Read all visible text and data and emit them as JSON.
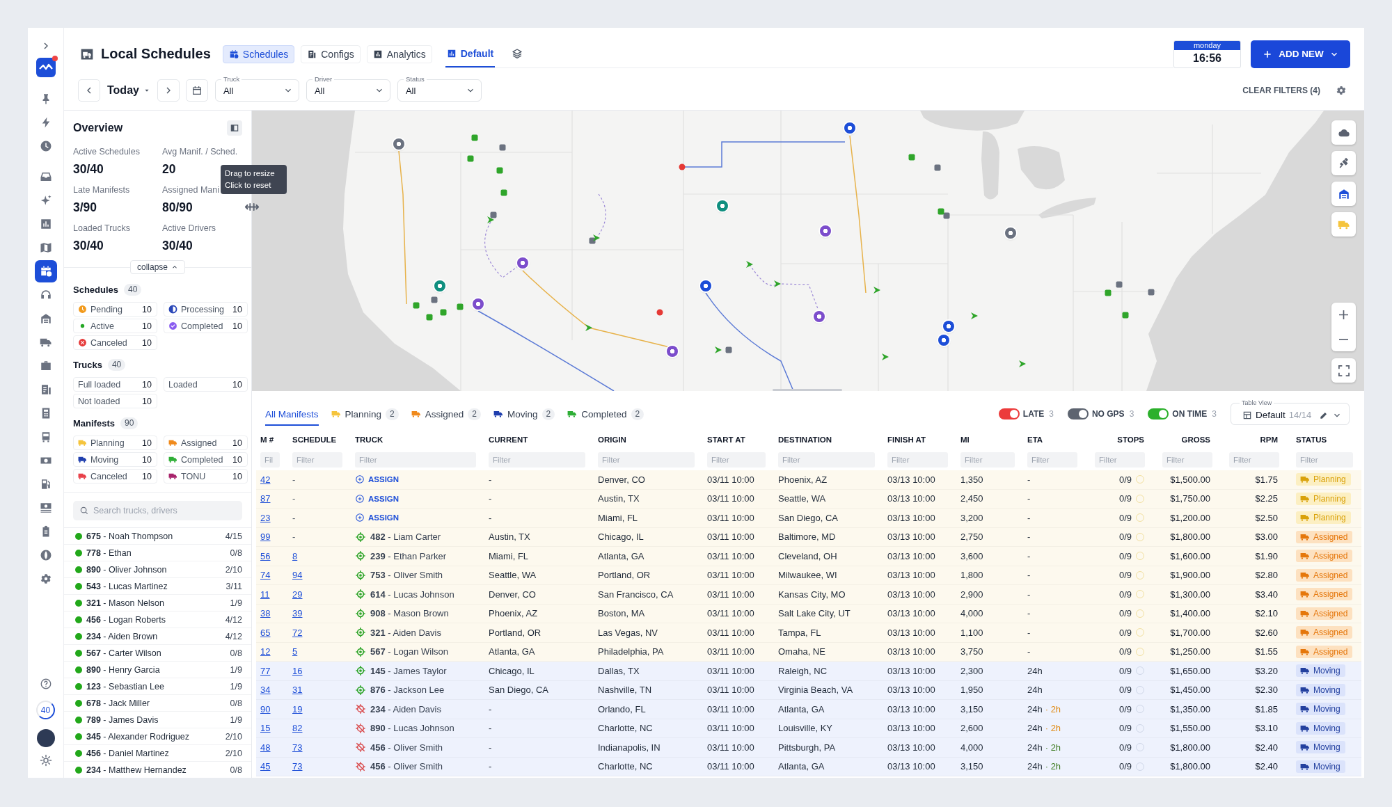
{
  "rail": {
    "groups": [
      [
        {
          "kind": "pin",
          "selected": false
        },
        {
          "kind": "bolt",
          "selected": false
        },
        {
          "kind": "clock",
          "selected": false
        }
      ],
      [
        {
          "kind": "inbox",
          "selected": false
        },
        {
          "kind": "sparkle",
          "selected": false
        },
        {
          "kind": "chart",
          "selected": false
        },
        {
          "kind": "map",
          "selected": false
        },
        {
          "kind": "calendar",
          "selected": true
        },
        {
          "kind": "headset",
          "selected": false
        },
        {
          "kind": "building",
          "selected": false
        },
        {
          "kind": "truck",
          "selected": false
        },
        {
          "kind": "briefcase",
          "selected": false
        },
        {
          "kind": "list",
          "selected": false
        },
        {
          "kind": "calculator",
          "selected": false
        },
        {
          "kind": "bus",
          "selected": false
        },
        {
          "kind": "banknote",
          "selected": false
        },
        {
          "kind": "fuel",
          "selected": false
        },
        {
          "kind": "cash",
          "selected": false
        },
        {
          "kind": "clipboard",
          "selected": false
        },
        {
          "kind": "globe",
          "selected": false
        },
        {
          "kind": "gear",
          "selected": false
        }
      ]
    ],
    "counter": "40"
  },
  "header": {
    "title": "Local Schedules",
    "view_tabs": [
      {
        "label": "Schedules",
        "selected": true
      },
      {
        "label": "Configs",
        "selected": false
      },
      {
        "label": "Analytics",
        "selected": false
      }
    ],
    "layout_tabs": [
      {
        "label": "Default",
        "selected": true
      }
    ],
    "clock": {
      "day": "monday",
      "time": "16:56"
    },
    "add_button": "ADD NEW"
  },
  "filters": {
    "date": "Today",
    "selects": [
      {
        "label": "Truck",
        "value": "All"
      },
      {
        "label": "Driver",
        "value": "All"
      },
      {
        "label": "Status",
        "value": "All"
      }
    ],
    "clear": "CLEAR FILTERS (4)"
  },
  "overview": {
    "title": "Overview",
    "stats": [
      {
        "label": "Active Schedules",
        "value": "30/40"
      },
      {
        "label": "Avg Manif. / Sched.",
        "value": "20"
      },
      {
        "label": "Late Manifests",
        "value": "3/90"
      },
      {
        "label": "Assigned Mani",
        "value": "80/90"
      },
      {
        "label": "Loaded Trucks",
        "value": "30/40"
      },
      {
        "label": "Active Drivers",
        "value": "30/40"
      }
    ],
    "collapse": "collapse",
    "tooltip": [
      "Drag to resize",
      "Click to reset"
    ]
  },
  "summary": [
    {
      "title": "Schedules",
      "count": "40",
      "chips": [
        {
          "label": "Pending",
          "value": "10",
          "kind": "pending",
          "color": "#f29a1c"
        },
        {
          "label": "Processing",
          "value": "10",
          "kind": "processing",
          "color": "#2a47b8"
        },
        {
          "label": "Active",
          "value": "10",
          "kind": "active",
          "color": "#25a825"
        },
        {
          "label": "Completed",
          "value": "10",
          "kind": "completed",
          "color": "#8a5cf0"
        },
        {
          "label": "Canceled",
          "value": "10",
          "kind": "canceled",
          "color": "#e63a3a"
        }
      ]
    },
    {
      "title": "Trucks",
      "count": "40",
      "chips": [
        {
          "label": "Full loaded",
          "value": "10",
          "kind": "plain"
        },
        {
          "label": "Loaded",
          "value": "10",
          "kind": "plain"
        },
        {
          "label": "Not loaded",
          "value": "10",
          "kind": "plain"
        }
      ]
    },
    {
      "title": "Manifests",
      "count": "90",
      "chips": [
        {
          "label": "Planning",
          "value": "10",
          "kind": "truck",
          "color": "#f5c43c"
        },
        {
          "label": "Assigned",
          "value": "10",
          "kind": "truck",
          "color": "#f08a1c"
        },
        {
          "label": "Moving",
          "value": "10",
          "kind": "truck",
          "color": "#1f3fae"
        },
        {
          "label": "Completed",
          "value": "10",
          "kind": "truck",
          "color": "#2eae36"
        },
        {
          "label": "Canceled",
          "value": "10",
          "kind": "truck",
          "color": "#e8414a"
        },
        {
          "label": "TONU",
          "value": "10",
          "kind": "truck",
          "color": "#a8246c"
        }
      ]
    }
  ],
  "search": {
    "placeholder": "Search trucks, drivers"
  },
  "drivers": [
    {
      "label": "**675** - Noah Thompson",
      "count": "4/15"
    },
    {
      "label": "**778** - Ethan",
      "count": "0/8"
    },
    {
      "label": "**890** - Oliver Johnson",
      "count": "2/10"
    },
    {
      "label": "**543** - Lucas Martinez",
      "count": "3/11"
    },
    {
      "label": "**321** - Mason Nelson",
      "count": "1/9"
    },
    {
      "label": "**456** - Logan Roberts",
      "count": "4/12"
    },
    {
      "label": "**234** - Aiden Brown",
      "count": "4/12"
    },
    {
      "label": "**567** - Carter Wilson",
      "count": "0/8"
    },
    {
      "label": "**890** - Henry Garcia",
      "count": "1/9"
    },
    {
      "label": "**123** - Sebastian Lee",
      "count": "1/9"
    },
    {
      "label": "**678** - Jack Miller",
      "count": "0/8"
    },
    {
      "label": "**789** - James Davis",
      "count": "1/9"
    },
    {
      "label": "**345** - Alexander Rodriguez",
      "count": "2/10"
    },
    {
      "label": "**456** - Daniel Martinez",
      "count": "2/10"
    },
    {
      "label": "**234** - Matthew Hernandez",
      "count": "0/8"
    }
  ],
  "map": {
    "layers": [
      {
        "kind": "cloud",
        "on": false
      },
      {
        "kind": "satellite",
        "on": false
      },
      {
        "kind": "depot",
        "on": true,
        "color": "#1d4ed8"
      },
      {
        "kind": "trucks",
        "on": true,
        "color": "#f5c43c"
      }
    ]
  },
  "manifest_tabs": [
    {
      "label": "All Manifests",
      "selected": true
    },
    {
      "label": "Planning",
      "count": "2",
      "color": "#f5c43c",
      "selected": false
    },
    {
      "label": "Assigned",
      "count": "2",
      "color": "#f08a1c",
      "selected": false
    },
    {
      "label": "Moving",
      "count": "2",
      "color": "#1f3fae",
      "selected": false
    },
    {
      "label": "Completed",
      "count": "2",
      "color": "#2eae36",
      "selected": false
    }
  ],
  "toggles": [
    {
      "label": "LATE",
      "count": "3",
      "on": true,
      "color": "#ec3b3b"
    },
    {
      "label": "NO GPS",
      "count": "3",
      "on": true,
      "color": "#5d6470"
    },
    {
      "label": "ON TIME",
      "count": "3",
      "on": true,
      "color": "#2cb02c"
    }
  ],
  "table_view": {
    "label": "Table View",
    "value": "Default",
    "count": "14/14"
  },
  "table": {
    "columns": [
      {
        "label": "M #",
        "placeholder": "Fil"
      },
      {
        "label": "SCHEDULE",
        "placeholder": "Filter"
      },
      {
        "label": "TRUCK",
        "placeholder": "Filter"
      },
      {
        "label": "CURRENT",
        "placeholder": "Filter"
      },
      {
        "label": "ORIGIN",
        "placeholder": "Filter"
      },
      {
        "label": "START AT",
        "placeholder": "Filter"
      },
      {
        "label": "DESTINATION",
        "placeholder": "Filter"
      },
      {
        "label": "FINISH AT",
        "placeholder": "Filter"
      },
      {
        "label": "MI",
        "placeholder": "Filter"
      },
      {
        "label": "ETA",
        "placeholder": "Filter"
      },
      {
        "label": "STOPS",
        "placeholder": "Filter"
      },
      {
        "label": "GROSS",
        "placeholder": "Filter"
      },
      {
        "label": "RPM",
        "placeholder": "Filter"
      },
      {
        "label": "STATUS",
        "placeholder": "Filter"
      }
    ],
    "rows": [
      {
        "m": "42",
        "schedule": "-",
        "schedule_link": false,
        "truck": {
          "kind": "assign",
          "label": "ASSIGN"
        },
        "current": "-",
        "origin": "Denver, CO",
        "start": "03/11 10:00",
        "destination": "Phoenix, AZ",
        "finish": "03/13 10:00",
        "mi": "1,350",
        "eta": "-",
        "stops": "0/9",
        "gross": "$1,500.00",
        "rpm": "$1.75",
        "status": {
          "label": "Planning",
          "kind": "planning"
        }
      },
      {
        "m": "87",
        "schedule": "-",
        "schedule_link": false,
        "truck": {
          "kind": "assign",
          "label": "ASSIGN"
        },
        "current": "-",
        "origin": "Austin, TX",
        "start": "03/11 10:00",
        "destination": "Seattle, WA",
        "finish": "03/13 10:00",
        "mi": "2,450",
        "eta": "-",
        "stops": "0/9",
        "gross": "$1,750.00",
        "rpm": "$2.25",
        "status": {
          "label": "Planning",
          "kind": "planning"
        }
      },
      {
        "m": "23",
        "schedule": "-",
        "schedule_link": false,
        "truck": {
          "kind": "assign",
          "label": "ASSIGN"
        },
        "current": "-",
        "origin": "Miami, FL",
        "start": "03/11 10:00",
        "destination": "San Diego, CA",
        "finish": "03/13 10:00",
        "mi": "3,200",
        "eta": "-",
        "stops": "0/9",
        "gross": "$1,200.00",
        "rpm": "$2.50",
        "status": {
          "label": "Planning",
          "kind": "planning"
        }
      },
      {
        "m": "99",
        "schedule": "-",
        "schedule_link": false,
        "truck": {
          "kind": "gps",
          "label": "**482** - Liam Carter"
        },
        "current": "Austin, TX",
        "origin": "Chicago, IL",
        "start": "03/11 10:00",
        "destination": "Baltimore, MD",
        "finish": "03/13 10:00",
        "mi": "2,750",
        "eta": "-",
        "stops": "0/9",
        "gross": "$1,800.00",
        "rpm": "$3.00",
        "status": {
          "label": "Assigned",
          "kind": "assigned"
        }
      },
      {
        "m": "56",
        "schedule": "8",
        "schedule_link": true,
        "truck": {
          "kind": "gps",
          "label": "**239** - Ethan Parker"
        },
        "current": "Miami, FL",
        "origin": "Atlanta, GA",
        "start": "03/11 10:00",
        "destination": "Cleveland, OH",
        "finish": "03/13 10:00",
        "mi": "3,600",
        "eta": "-",
        "stops": "0/9",
        "gross": "$1,600.00",
        "rpm": "$1.90",
        "status": {
          "label": "Assigned",
          "kind": "assigned"
        }
      },
      {
        "m": "74",
        "schedule": "94",
        "schedule_link": true,
        "truck": {
          "kind": "gps",
          "label": "**753** - Oliver Smith"
        },
        "current": "Seattle, WA",
        "origin": "Portland, OR",
        "start": "03/11 10:00",
        "destination": "Milwaukee, WI",
        "finish": "03/13 10:00",
        "mi": "1,800",
        "eta": "-",
        "stops": "0/9",
        "gross": "$1,900.00",
        "rpm": "$2.80",
        "status": {
          "label": "Assigned",
          "kind": "assigned"
        }
      },
      {
        "m": "11",
        "schedule": "29",
        "schedule_link": true,
        "truck": {
          "kind": "gps",
          "label": "**614** - Lucas Johnson"
        },
        "current": "Denver, CO",
        "origin": "San Francisco, CA",
        "start": "03/11 10:00",
        "destination": "Kansas City, MO",
        "finish": "03/13 10:00",
        "mi": "2,900",
        "eta": "-",
        "stops": "0/9",
        "gross": "$1,300.00",
        "rpm": "$3.40",
        "status": {
          "label": "Assigned",
          "kind": "assigned"
        }
      },
      {
        "m": "38",
        "schedule": "39",
        "schedule_link": true,
        "truck": {
          "kind": "gps",
          "label": "**908** - Mason Brown"
        },
        "current": "Phoenix, AZ",
        "origin": "Boston, MA",
        "start": "03/11 10:00",
        "destination": "Salt Lake City, UT",
        "finish": "03/13 10:00",
        "mi": "4,000",
        "eta": "-",
        "stops": "0/9",
        "gross": "$1,400.00",
        "rpm": "$2.10",
        "status": {
          "label": "Assigned",
          "kind": "assigned"
        }
      },
      {
        "m": "65",
        "schedule": "72",
        "schedule_link": true,
        "truck": {
          "kind": "gps",
          "label": "**321** - Aiden Davis"
        },
        "current": "Portland, OR",
        "origin": "Las Vegas, NV",
        "start": "03/11 10:00",
        "destination": "Tampa, FL",
        "finish": "03/13 10:00",
        "mi": "1,100",
        "eta": "-",
        "stops": "0/9",
        "gross": "$1,700.00",
        "rpm": "$2.60",
        "status": {
          "label": "Assigned",
          "kind": "assigned"
        }
      },
      {
        "m": "12",
        "schedule": "5",
        "schedule_link": true,
        "truck": {
          "kind": "gps",
          "label": "**567** - Logan Wilson"
        },
        "current": "Atlanta, GA",
        "origin": "Philadelphia, PA",
        "start": "03/11 10:00",
        "destination": "Omaha, NE",
        "finish": "03/13 10:00",
        "mi": "3,750",
        "eta": "-",
        "stops": "0/9",
        "gross": "$1,250.00",
        "rpm": "$1.55",
        "status": {
          "label": "Assigned",
          "kind": "assigned"
        }
      },
      {
        "m": "77",
        "schedule": "16",
        "schedule_link": true,
        "truck": {
          "kind": "gps",
          "label": "**145** - James Taylor"
        },
        "current": "Chicago, IL",
        "origin": "Dallas, TX",
        "start": "03/11 10:00",
        "destination": "Raleigh, NC",
        "finish": "03/13 10:00",
        "mi": "2,300",
        "eta": "24h",
        "stops": "0/9",
        "gross": "$1,650.00",
        "rpm": "$3.20",
        "status": {
          "label": "Moving",
          "kind": "moving"
        }
      },
      {
        "m": "34",
        "schedule": "31",
        "schedule_link": true,
        "truck": {
          "kind": "gps",
          "label": "**876** - Jackson Lee"
        },
        "current": "San Diego, CA",
        "origin": "Nashville, TN",
        "start": "03/11 10:00",
        "destination": "Virginia Beach, VA",
        "finish": "03/13 10:00",
        "mi": "1,950",
        "eta": "24h",
        "stops": "0/9",
        "gross": "$1,450.00",
        "rpm": "$2.30",
        "status": {
          "label": "Moving",
          "kind": "moving"
        }
      },
      {
        "m": "90",
        "schedule": "19",
        "schedule_link": true,
        "truck": {
          "kind": "no_gps",
          "label": "**234** - Aiden Davis"
        },
        "current": "-",
        "origin": "Orlando, FL",
        "start": "03/11 10:00",
        "destination": "Atlanta, GA",
        "finish": "03/13 10:00",
        "mi": "3,150",
        "eta": "24h",
        "delay": {
          "text": "· 2h",
          "color": "#e08a12"
        },
        "stops": "0/9",
        "gross": "$1,350.00",
        "rpm": "$1.85",
        "status": {
          "label": "Moving",
          "kind": "moving"
        }
      },
      {
        "m": "15",
        "schedule": "82",
        "schedule_link": true,
        "truck": {
          "kind": "no_gps",
          "label": "**890** - Lucas Johnson"
        },
        "current": "-",
        "origin": "Charlotte, NC",
        "start": "03/11 10:00",
        "destination": "Louisville, KY",
        "finish": "03/13 10:00",
        "mi": "2,600",
        "eta": "24h",
        "delay": {
          "text": "· 2h",
          "color": "#e08a12"
        },
        "stops": "0/9",
        "gross": "$1,550.00",
        "rpm": "$3.10",
        "status": {
          "label": "Moving",
          "kind": "moving"
        }
      },
      {
        "m": "48",
        "schedule": "73",
        "schedule_link": true,
        "truck": {
          "kind": "no_gps",
          "label": "**456** - Oliver Smith"
        },
        "current": "-",
        "origin": "Indianapolis, IN",
        "start": "03/11 10:00",
        "destination": "Pittsburgh, PA",
        "finish": "03/13 10:00",
        "mi": "4,000",
        "eta": "24h",
        "delay": {
          "text": "· 2h",
          "color": "#3b7a1e"
        },
        "stops": "0/9",
        "gross": "$1,800.00",
        "rpm": "$2.40",
        "status": {
          "label": "Moving",
          "kind": "moving"
        }
      },
      {
        "m": "45",
        "schedule": "73",
        "schedule_link": true,
        "truck": {
          "kind": "no_gps",
          "label": "**456** - Oliver Smith"
        },
        "current": "-",
        "origin": "Charlotte, NC",
        "start": "03/11 10:00",
        "destination": "Atlanta, GA",
        "finish": "03/13 10:00",
        "mi": "3,150",
        "eta": "24h",
        "delay": {
          "text": "· 2h",
          "color": "#3b7a1e"
        },
        "stops": "0/9",
        "gross": "$1,800.00",
        "rpm": "$2.40",
        "status": {
          "label": "Moving",
          "kind": "moving"
        }
      }
    ]
  }
}
